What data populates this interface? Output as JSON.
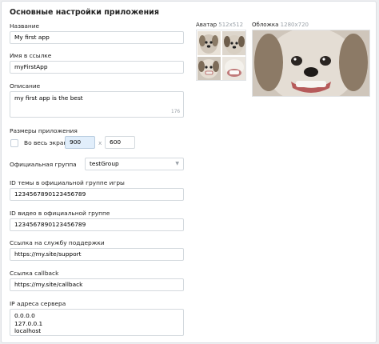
{
  "title": "Основные настройки приложения",
  "name": {
    "label": "Название",
    "value": "My first app"
  },
  "link_name": {
    "label": "Имя в ссылке",
    "value": "myFirstApp"
  },
  "description": {
    "label": "Описание",
    "value": "my first app is the best",
    "counter": "176"
  },
  "size": {
    "label": "Размеры приложения",
    "fullscreen_label": "Во весь экран",
    "width": "900",
    "separator": "x",
    "height": "600"
  },
  "group": {
    "label": "Официальная группа",
    "value": "testGroup",
    "arrow_icon": "chevron-down-icon"
  },
  "topic_id": {
    "label": "ID темы в официальной группе игры",
    "value": "1234567890123456789"
  },
  "video_id": {
    "label": "ID видео в официальной группе",
    "value": "1234567890123456789"
  },
  "support": {
    "label": "Ссылка на службу поддержки",
    "value": "https://my.site/support"
  },
  "callback": {
    "label": "Ссылка callback",
    "value": "https://my.site/callback"
  },
  "ips": {
    "label": "IP адреса сервера",
    "value": "0.0.0.0\n127.0.0.1\nlocalhost"
  },
  "avatar": {
    "label": "Аватар",
    "size": "512x512"
  },
  "cover": {
    "label": "Обложка",
    "size": "1280x720"
  }
}
